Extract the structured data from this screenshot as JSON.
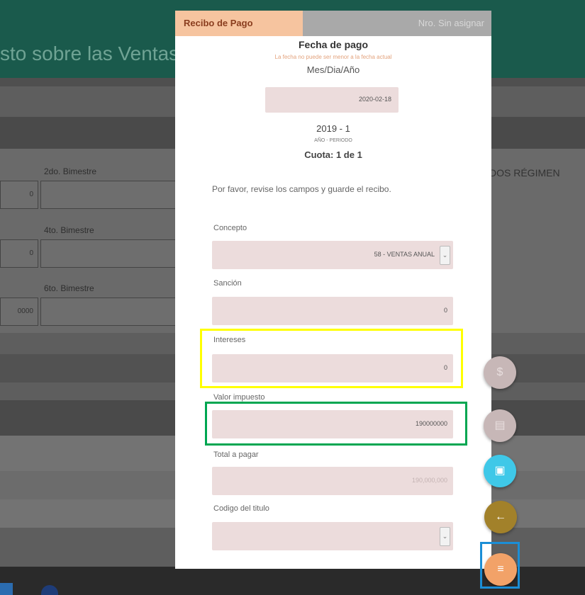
{
  "background": {
    "page_title": "sto sobre las Ventas",
    "fields": [
      {
        "label": "2do. Bimestre",
        "left_value": "0"
      },
      {
        "label": "4to. Bimestre",
        "left_value": "0"
      },
      {
        "label": "6to. Bimestre",
        "left_value": "0000"
      }
    ],
    "regimen_text": "DOS RÉGIMEN"
  },
  "modal": {
    "tab_active": "Recibo de Pago",
    "tab_inactive": "Nro. Sin asignar",
    "fecha_title": "Fecha de pago",
    "fecha_note": "La fecha no puede ser menor a la fecha actual",
    "fecha_format": "Mes/Dia/Año",
    "fecha_value": "2020-02-18",
    "period": "2019 - 1",
    "period_label": "AÑO - PERIODO",
    "cuota": "Cuota:  1 de 1",
    "instructions": "Por favor, revise los campos y guarde el recibo.",
    "fields": {
      "concepto": {
        "label": "Concepto",
        "value": "58 - VENTAS ANUAL"
      },
      "sancion": {
        "label": "Sanción",
        "value": "0"
      },
      "intereses": {
        "label": "Intereses",
        "value": "0"
      },
      "valor_impuesto": {
        "label": "Valor impuesto",
        "value": "190000000"
      },
      "total_pagar": {
        "label": "Total a pagar",
        "value": "190,000,000"
      },
      "codigo_titulo": {
        "label": "Codigo del titulo",
        "value": ""
      }
    }
  },
  "fabs": {
    "dollar": "$",
    "print": "▤",
    "save": "▣",
    "back": "←",
    "menu": "≡"
  },
  "colors": {
    "header_tab": "#f6c49f",
    "field_bg": "#ecdcdc",
    "highlight_yellow": "#ffff00",
    "highlight_green": "#00a651",
    "highlight_blue": "#1b8ed6",
    "fab_save": "#3fc8e8",
    "fab_back": "#a2812a",
    "fab_menu": "#f2a268"
  }
}
